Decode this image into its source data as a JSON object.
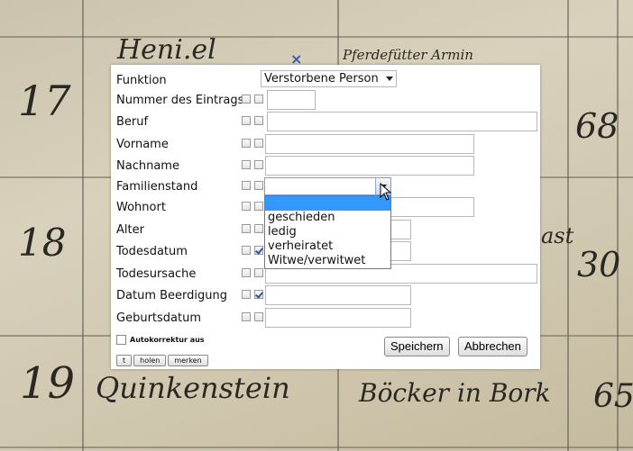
{
  "background": {
    "entries": [
      {
        "number": "17",
        "text_top": "Heni.el",
        "text_right": "Pferdefütter Armin",
        "value": "68"
      },
      {
        "number": "18",
        "value": "30",
        "fragment": "ast"
      },
      {
        "number": "19",
        "name": "Quinkenstein",
        "place": "Böcker in Bork",
        "value": "65"
      }
    ]
  },
  "dialog": {
    "fields": [
      {
        "label": "Funktion",
        "type": "select",
        "value": "Verstorbene Person"
      },
      {
        "label": "Nummer des Eintrags",
        "cb1": false,
        "cb2": false,
        "value": ""
      },
      {
        "label": "Beruf",
        "cb1": false,
        "cb2": false,
        "value": ""
      },
      {
        "label": "Vorname",
        "cb1": false,
        "cb2": false,
        "value": ""
      },
      {
        "label": "Nachname",
        "cb1": false,
        "cb2": false,
        "value": ""
      },
      {
        "label": "Familienstand",
        "cb1": false,
        "cb2": false,
        "value": ""
      },
      {
        "label": "Wohnort",
        "cb1": false,
        "cb2": false,
        "value": ""
      },
      {
        "label": "Alter",
        "cb1": false,
        "cb2": false,
        "value": ""
      },
      {
        "label": "Todesdatum",
        "cb1": false,
        "cb2": true,
        "value": ""
      },
      {
        "label": "Todesursache",
        "cb1": false,
        "cb2": false,
        "value": ""
      },
      {
        "label": "Datum Beerdigung",
        "cb1": false,
        "cb2": true,
        "value": ""
      },
      {
        "label": "Geburtsdatum",
        "cb1": false,
        "cb2": false,
        "value": ""
      }
    ],
    "familienstand_options": [
      "",
      "geschieden",
      "ledig",
      "verheiratet",
      "Witwe/verwitwet"
    ],
    "autokorrektur_label": "Autokorrektur aus",
    "small_buttons": [
      "t",
      "holen",
      "merken"
    ],
    "save_label": "Speichern",
    "cancel_label": "Abbrechen",
    "close_glyph": "×"
  },
  "colors": {
    "highlight": "#3399ff",
    "check": "#3a4fa0",
    "close": "#3b5aa8"
  }
}
